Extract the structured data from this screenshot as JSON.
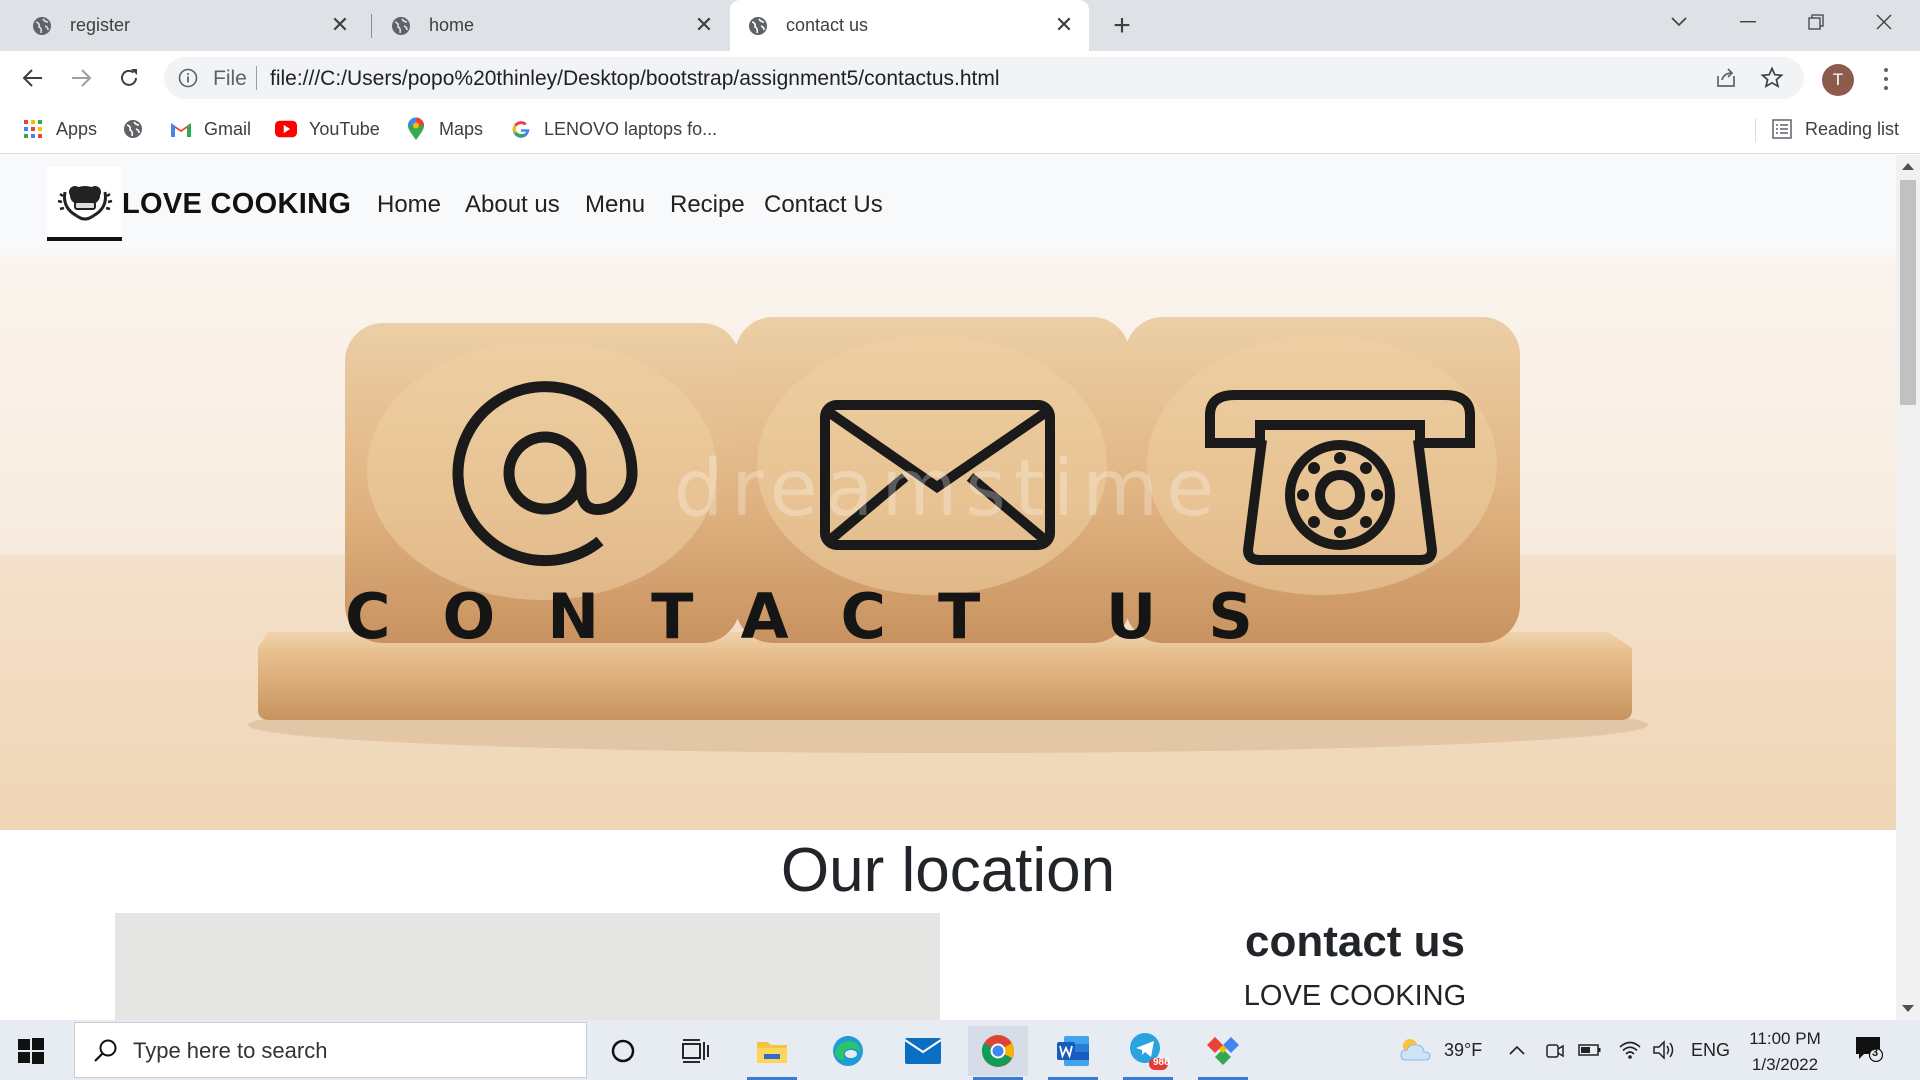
{
  "browser": {
    "tabs": [
      {
        "title": "register",
        "icon": "globe-icon",
        "active": false
      },
      {
        "title": "home",
        "icon": "globe-icon",
        "active": false
      },
      {
        "title": "contact us",
        "icon": "globe-icon",
        "active": true
      }
    ],
    "address": {
      "scheme_label": "File",
      "url": "file:///C:/Users/popo%20thinley/Desktop/bootstrap/assignment5/contactus.html"
    },
    "profile_initial": "T",
    "bookmarks": [
      {
        "label": "Apps",
        "icon": "apps-grid-icon"
      },
      {
        "label": "",
        "icon": "globe-icon"
      },
      {
        "label": "Gmail",
        "icon": "gmail-icon"
      },
      {
        "label": "YouTube",
        "icon": "youtube-icon"
      },
      {
        "label": "Maps",
        "icon": "maps-pin-icon"
      },
      {
        "label": "LENOVO laptops fo...",
        "icon": "google-icon"
      }
    ],
    "reading_list": "Reading list"
  },
  "page": {
    "brand": "LOVE COOKING",
    "nav": [
      "Home",
      "About us",
      "Menu",
      "Recipe",
      "Contact Us"
    ],
    "hero": {
      "banner_text": "CONTACT US",
      "block_icons": [
        "at-sign-icon",
        "envelope-icon",
        "telephone-icon"
      ],
      "watermark": "dreamstime"
    },
    "location_title": "Our location",
    "contact_title": "contact us",
    "contact_sub": "LOVE COOKING"
  },
  "taskbar": {
    "search_placeholder": "Type here to search",
    "weather": "39°F",
    "language": "ENG",
    "time": "11:00 PM",
    "date": "1/3/2022",
    "notification_count": "3",
    "telegram_badge": "986"
  },
  "colors": {
    "tabstrip": "#dee1e6",
    "navbar": "#f8f9fa",
    "taskbar": "#e7ecf3",
    "wood": "#e2b98a",
    "text_dark": "#212529"
  }
}
